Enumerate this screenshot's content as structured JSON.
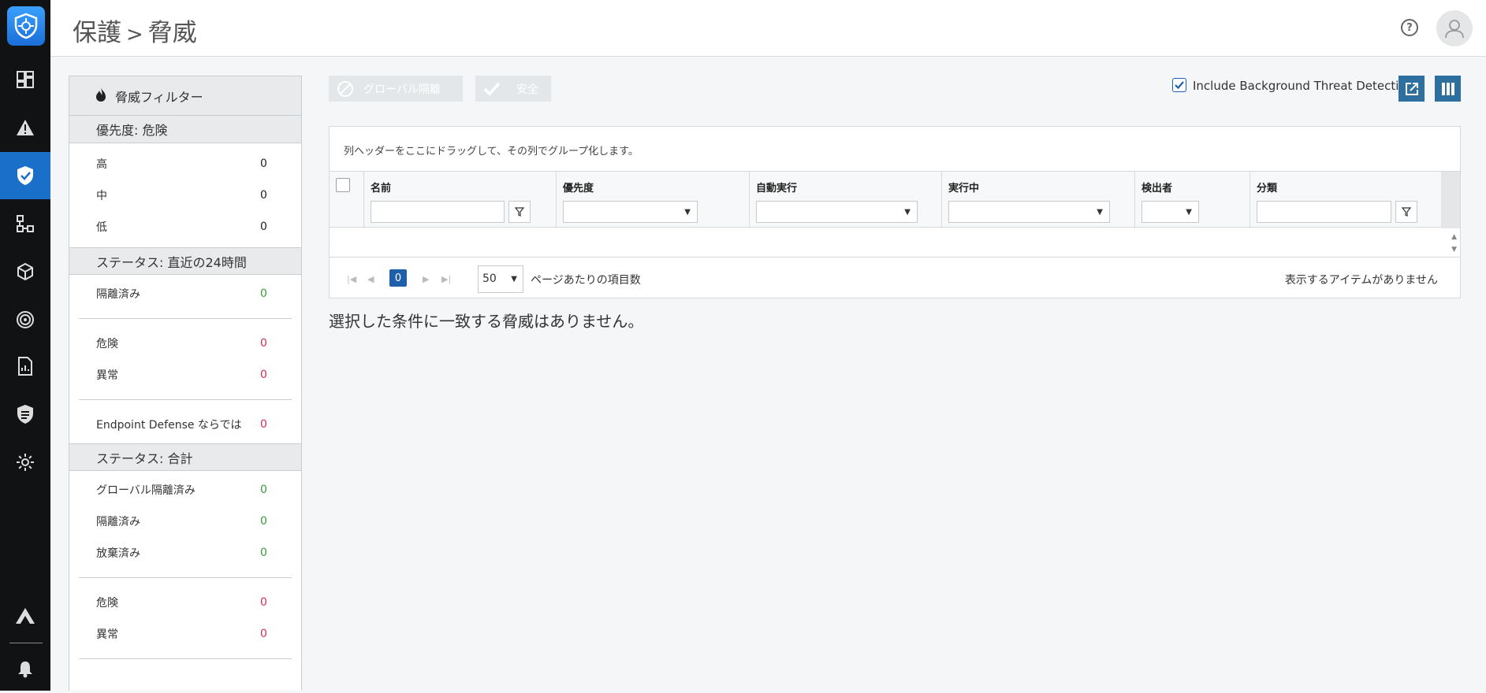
{
  "header": {
    "breadcrumb_root": "保護",
    "breadcrumb_sep": ">",
    "breadcrumb_current": "脅威",
    "help_label": "?"
  },
  "nav": {
    "items": [
      {
        "icon": "dashboard-icon"
      },
      {
        "icon": "alert-icon"
      },
      {
        "icon": "shield-check-icon",
        "active": true
      },
      {
        "icon": "network-icon"
      },
      {
        "icon": "cube-icon"
      },
      {
        "icon": "target-icon"
      },
      {
        "icon": "report-icon"
      },
      {
        "icon": "policy-shield-icon"
      },
      {
        "icon": "gear-icon"
      },
      {
        "icon": "logo-a-icon"
      },
      {
        "icon": "bell-icon"
      }
    ]
  },
  "filter": {
    "title": "脅威フィルター",
    "sections": {
      "priority": {
        "title": "優先度: 危険",
        "rows": [
          {
            "label": "高",
            "value": "0"
          },
          {
            "label": "中",
            "value": "0"
          },
          {
            "label": "低",
            "value": "0"
          }
        ]
      },
      "status24": {
        "title": "ステータス: 直近の24時間",
        "quarantined": {
          "label": "隔離済み",
          "value": "0"
        },
        "danger": {
          "label": "危険",
          "value": "0"
        },
        "abnormal": {
          "label": "異常",
          "value": "0"
        },
        "endpoint": {
          "label": "Endpoint Defense ならでは",
          "value": "0"
        }
      },
      "total": {
        "title": "ステータス: 合計",
        "global_quarantined": {
          "label": "グローバル隔離済み",
          "value": "0"
        },
        "quarantined": {
          "label": "隔離済み",
          "value": "0"
        },
        "abandoned": {
          "label": "放棄済み",
          "value": "0"
        },
        "danger": {
          "label": "危険",
          "value": "0"
        },
        "abnormal": {
          "label": "異常",
          "value": "0"
        }
      }
    }
  },
  "toolbar": {
    "global_block_label": "グローバル隔離",
    "safe_label": "安全",
    "include_bg_label": "Include Background Threat Detections",
    "include_bg_checked": true
  },
  "grid": {
    "group_hint": "列ヘッダーをここにドラッグして、その列でグループ化します。",
    "columns": [
      "名前",
      "優先度",
      "自動実行",
      "実行中",
      "検出者",
      "分類"
    ],
    "pager": {
      "current_page": "0",
      "page_size": "50",
      "page_size_label": "ページあたりの項目数",
      "empty_label": "表示するアイテムがありません"
    }
  },
  "empty_message": "選択した条件に一致する脅威はありません。",
  "colors": {
    "accent": "#1a6fc9",
    "count_green": "#3a9b3a",
    "count_red": "#d0305a"
  }
}
